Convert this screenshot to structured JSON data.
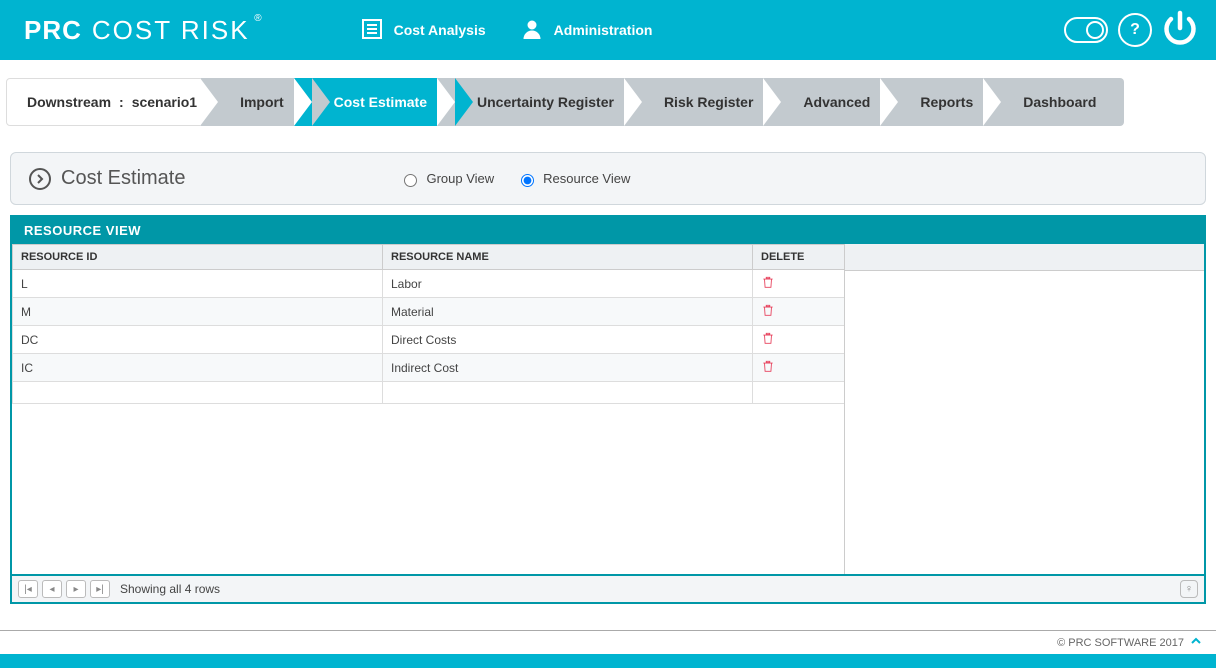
{
  "brand": {
    "bold": "PRC",
    "light": "COST RISK",
    "reg": "®"
  },
  "header_menu": [
    {
      "label": "Cost Analysis"
    },
    {
      "label": "Administration"
    }
  ],
  "breadcrumb": {
    "prefix": "Downstream",
    "sep": ":",
    "name": "scenario1"
  },
  "steps": [
    {
      "label": "Import",
      "active": false
    },
    {
      "label": "Cost Estimate",
      "active": true
    },
    {
      "label": "Uncertainty Register",
      "active": false
    },
    {
      "label": "Risk Register",
      "active": false
    },
    {
      "label": "Advanced",
      "active": false
    },
    {
      "label": "Reports",
      "active": false
    },
    {
      "label": "Dashboard",
      "active": false
    }
  ],
  "section": {
    "title": "Cost Estimate",
    "views": {
      "group": "Group View",
      "resource": "Resource View",
      "selected": "resource"
    }
  },
  "table": {
    "title": "RESOURCE VIEW",
    "columns": {
      "id": "RESOURCE ID",
      "name": "RESOURCE NAME",
      "delete": "DELETE"
    },
    "rows": [
      {
        "id": "L",
        "name": "Labor"
      },
      {
        "id": "M",
        "name": "Material"
      },
      {
        "id": "DC",
        "name": "Direct Costs"
      },
      {
        "id": "IC",
        "name": "Indirect Cost"
      }
    ],
    "pager_text": "Showing all 4 rows"
  },
  "footer": {
    "copyright": "© PRC SOFTWARE 2017"
  }
}
